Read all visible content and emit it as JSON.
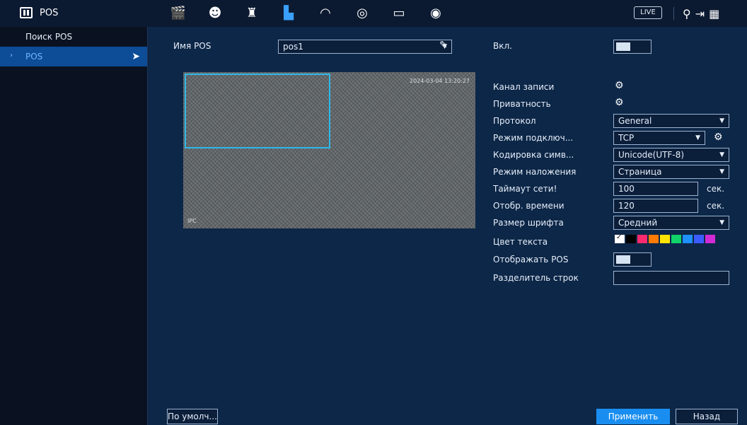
{
  "app": {
    "title": "POS"
  },
  "top_icons": [
    {
      "name": "clapperboard-icon",
      "glyph": "🎬"
    },
    {
      "name": "face-icon",
      "glyph": "☻"
    },
    {
      "name": "alarm-light-icon",
      "glyph": "♜"
    },
    {
      "name": "network-icon",
      "glyph": "▙"
    },
    {
      "name": "gauge-icon",
      "glyph": "◠"
    },
    {
      "name": "storage-icon",
      "glyph": "◎"
    },
    {
      "name": "monitor-icon",
      "glyph": "▭"
    },
    {
      "name": "speaker-icon",
      "glyph": "◉"
    }
  ],
  "top_right": {
    "live": "LIVE",
    "user_glyph": "⚲",
    "logout_glyph": "⇥",
    "qr_glyph": "▦"
  },
  "sidebar": {
    "items": [
      {
        "label": "Поиск POS",
        "active": false
      },
      {
        "label": "POS",
        "active": true
      }
    ]
  },
  "form": {
    "pos_name_label": "Имя POS",
    "pos_name_value": "pos1",
    "enable_label": "Вкл.",
    "video": {
      "timestamp": "2024-03-04 13:20:27",
      "channel": "IPC"
    },
    "rows": {
      "record_channel": "Канал записи",
      "privacy": "Приватность",
      "protocol_label": "Протокол",
      "protocol_value": "General",
      "conn_mode_label": "Режим подключ...",
      "conn_mode_value": "TCP",
      "encoding_label": "Кодировка симв...",
      "encoding_value": "Unicode(UTF-8)",
      "overlay_label": "Режим наложения",
      "overlay_value": "Страница",
      "timeout_label": "Таймаут сети!",
      "timeout_value": "100",
      "timeout_unit": "сек.",
      "display_time_label": "Отобр. времени",
      "display_time_value": "120",
      "display_time_unit": "сек.",
      "font_size_label": "Размер шрифта",
      "font_size_value": "Средний",
      "text_color_label": "Цвет текста",
      "show_pos_label": "Отображать POS",
      "line_sep_label": "Разделитель строк",
      "line_sep_value": ""
    },
    "colors": [
      "#ffffff",
      "#000000",
      "#ff2a6d",
      "#ff7a00",
      "#ffe400",
      "#10d36a",
      "#1e90ff",
      "#3b5cff",
      "#d12bd6"
    ]
  },
  "footer": {
    "default_btn": "По умолч...",
    "apply_btn": "Применить",
    "back_btn": "Назад"
  }
}
